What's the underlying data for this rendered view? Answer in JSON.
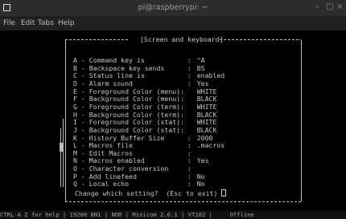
{
  "window": {
    "title": "pi@raspberrypi: ~",
    "app_icon": "terminal-icon",
    "controls": [
      "–",
      "□",
      "×"
    ]
  },
  "menu": {
    "file": "File",
    "edit": "Edit",
    "tabs": "Tabs",
    "help": "Help"
  },
  "dialog": {
    "header": "[Screen and keyboard]",
    "options": [
      {
        "key": "A",
        "label": "Command key is",
        "value": "^A"
      },
      {
        "key": "B",
        "label": "Backspace key sends",
        "value": "BS"
      },
      {
        "key": "C",
        "label": "Status line is",
        "value": "enabled"
      },
      {
        "key": "D",
        "label": "Alarm sound",
        "value": "Yes"
      },
      {
        "key": "E",
        "label": "Foreground Color (menu):",
        "value": "WHITE"
      },
      {
        "key": "F",
        "label": "Background Color (menu):",
        "value": "BLACK"
      },
      {
        "key": "G",
        "label": "Foreground Color (term):",
        "value": "WHITE"
      },
      {
        "key": "H",
        "label": "Background Color (term):",
        "value": "BLACK"
      },
      {
        "key": "I",
        "label": "Foreground Color (stat):",
        "value": "WHITE"
      },
      {
        "key": "J",
        "label": "Background Color (stat):",
        "value": "BLACK"
      },
      {
        "key": "K",
        "label": "History Buffer Size",
        "value": "2000"
      },
      {
        "key": "L",
        "label": "Macros file",
        "value": ".macros"
      },
      {
        "key": "M",
        "label": "Edit Macros",
        "value": ""
      },
      {
        "key": "N",
        "label": "Macros enabled",
        "value": "Yes"
      },
      {
        "key": "O",
        "label": "Character conversion",
        "value": ""
      },
      {
        "key": "P",
        "label": "Add linefeed",
        "value": "No"
      },
      {
        "key": "Q",
        "label": "Local echo",
        "value": "No"
      }
    ],
    "prompt": "Change which setting?  (Esc to exit)"
  },
  "statusbar": {
    "text": "CTRL-A Z for help | 19200 8N1 | NOR | Minicom 2.6.1 | VT102 |     Offline"
  },
  "colors": {
    "terminal_bg": "#000000",
    "terminal_fg": "#c8c8c8",
    "titlebar_bg": "#2d2d2d"
  }
}
